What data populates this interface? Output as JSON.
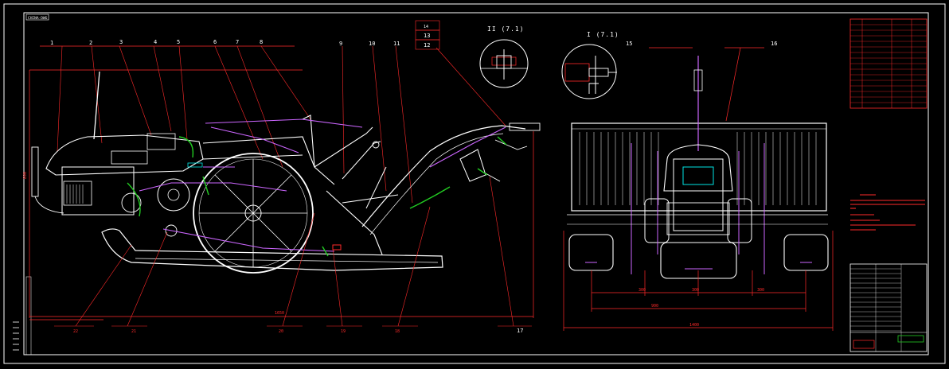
{
  "drawing": {
    "tag": "CHINA-DWG",
    "detail_ii": "II (7.1)",
    "detail_i": "I (7.1)"
  },
  "side_view": {
    "top_callouts": [
      "1",
      "2",
      "3",
      "4",
      "5",
      "6",
      "7",
      "8",
      "9",
      "10",
      "11"
    ],
    "stack_callouts": [
      "14",
      "13",
      "12"
    ],
    "bottom_callouts": [
      "22",
      "21",
      "20",
      "19",
      "18",
      "17"
    ],
    "overall_dim": "1650",
    "height_dim": "890"
  },
  "front_view": {
    "top_callouts": [
      "15",
      "16"
    ],
    "dims": [
      "300",
      "300",
      "300",
      "900",
      "1400"
    ]
  },
  "colors": {
    "background": "#000000",
    "outline": "#ffffff",
    "leader": "#ff2a2a",
    "hose": "#22cc22",
    "rod": "#cc66ff",
    "accent": "#00e5e5"
  }
}
